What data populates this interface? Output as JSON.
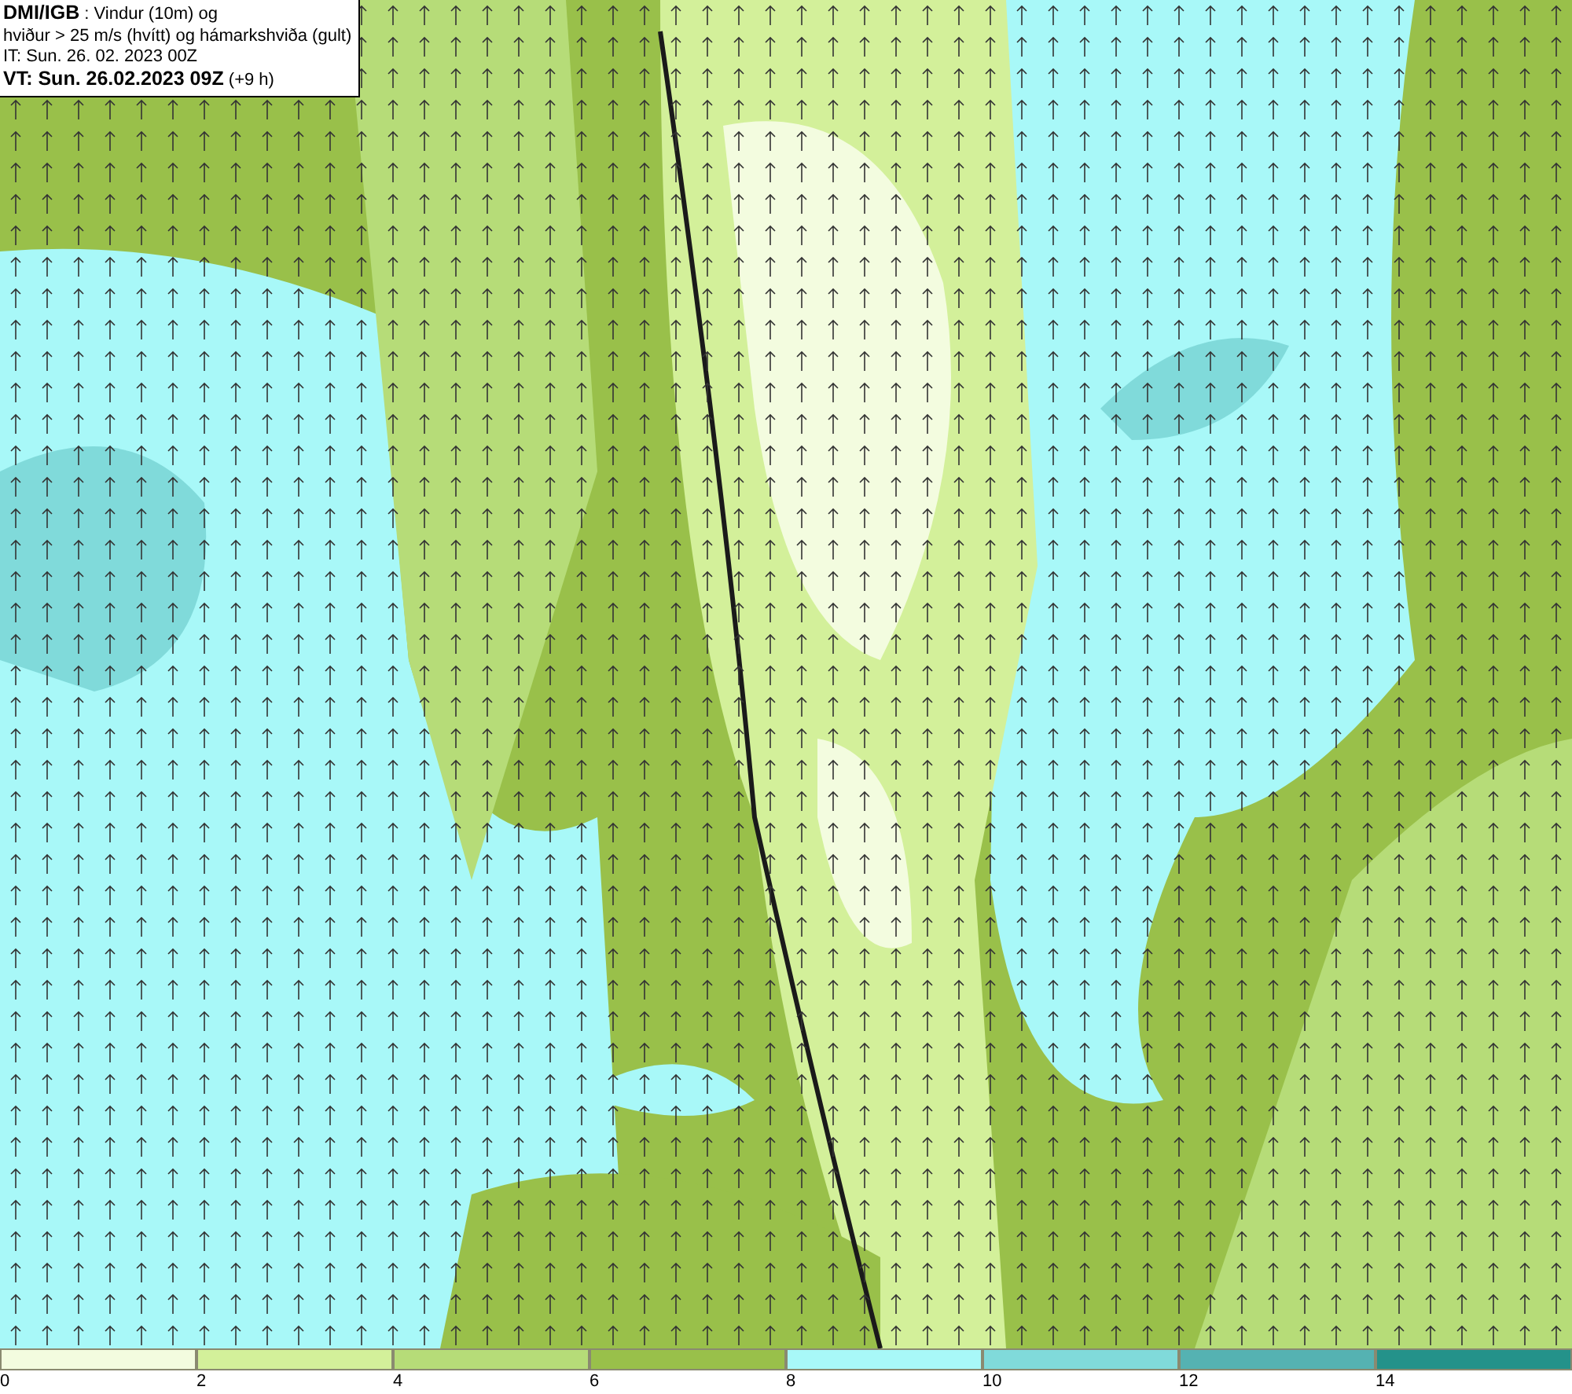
{
  "info_box": {
    "lines": [
      "**DMI/IGB** : Vindur (10m) og",
      "hviður > 25 m/s (hvítt) og hámarkshviða (gult)",
      "IT: Sun. 26. 02. 2023 00Z",
      "**VT: Sun. 26.02.2023 09Z** (+9 h)"
    ]
  },
  "legend": {
    "bins": [
      {
        "color": "#f3fcdf",
        "label": "0"
      },
      {
        "color": "#d3f09a",
        "label": "2"
      },
      {
        "color": "#b6dc78",
        "label": "4"
      },
      {
        "color": "#99c04a",
        "label": "6"
      },
      {
        "color": "#a8f8f8",
        "label": "8"
      },
      {
        "color": "#80dada",
        "label": "10"
      },
      {
        "color": "#55b2b2",
        "label": "12"
      },
      {
        "color": "#24928a",
        "label": "14"
      }
    ]
  }
}
